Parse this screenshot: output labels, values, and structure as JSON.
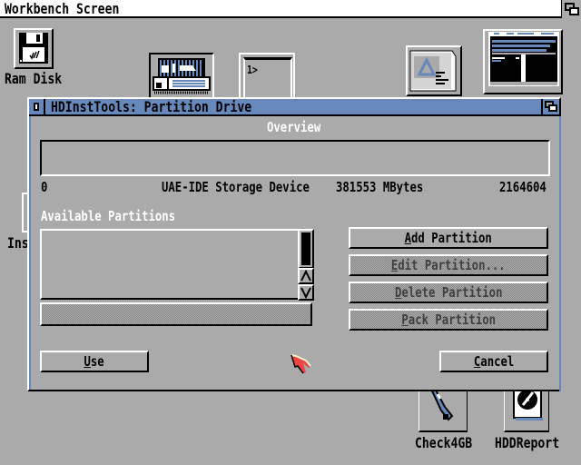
{
  "screen": {
    "title": "Workbench Screen"
  },
  "desktop_icons": [
    {
      "name": "ram-disk",
      "label": "Ram Disk"
    },
    {
      "name": "prefs-drawer",
      "label": ""
    },
    {
      "name": "shell",
      "label": "",
      "glyph": "1>"
    },
    {
      "name": "showconfig",
      "label": ""
    },
    {
      "name": "workbench-window",
      "label": ""
    },
    {
      "name": "installer",
      "label": "Ins"
    },
    {
      "name": "check4gb",
      "label": "Check4GB"
    },
    {
      "name": "hddreport",
      "label": "HDDReport"
    }
  ],
  "window": {
    "title": "HDInstTools: Partition Drive",
    "overview_label": "Overview",
    "drive": {
      "start": "0",
      "device": "UAE-IDE Storage Device",
      "size": "381553 MBytes",
      "end": "2164604"
    },
    "available_partitions_label": "Available Partitions",
    "partitions": [],
    "buttons": {
      "add": {
        "label": "Add Partition",
        "hotkey": "A",
        "rest": "dd Partition",
        "enabled": true
      },
      "edit": {
        "label": "Edit Partition...",
        "hotkey": "E",
        "rest": "dit Partition...",
        "enabled": false
      },
      "delete": {
        "label": "Delete Partition",
        "hotkey": "D",
        "rest": "elete Partition",
        "enabled": false
      },
      "pack": {
        "label": "Pack Partition",
        "hotkey": "P",
        "rest": "ack Partition",
        "enabled": false
      },
      "use": {
        "label": "Use",
        "hotkey": "U",
        "rest": "se"
      },
      "cancel": {
        "label": "Cancel",
        "hotkey": "C",
        "rest": "ancel"
      }
    },
    "scroll": {
      "up_glyph": "Λ",
      "down_glyph": "V"
    }
  },
  "colors": {
    "workbench_gray": "#aaaaaa",
    "title_blue": "#6688bb",
    "pointer_red": "#ee4444"
  }
}
